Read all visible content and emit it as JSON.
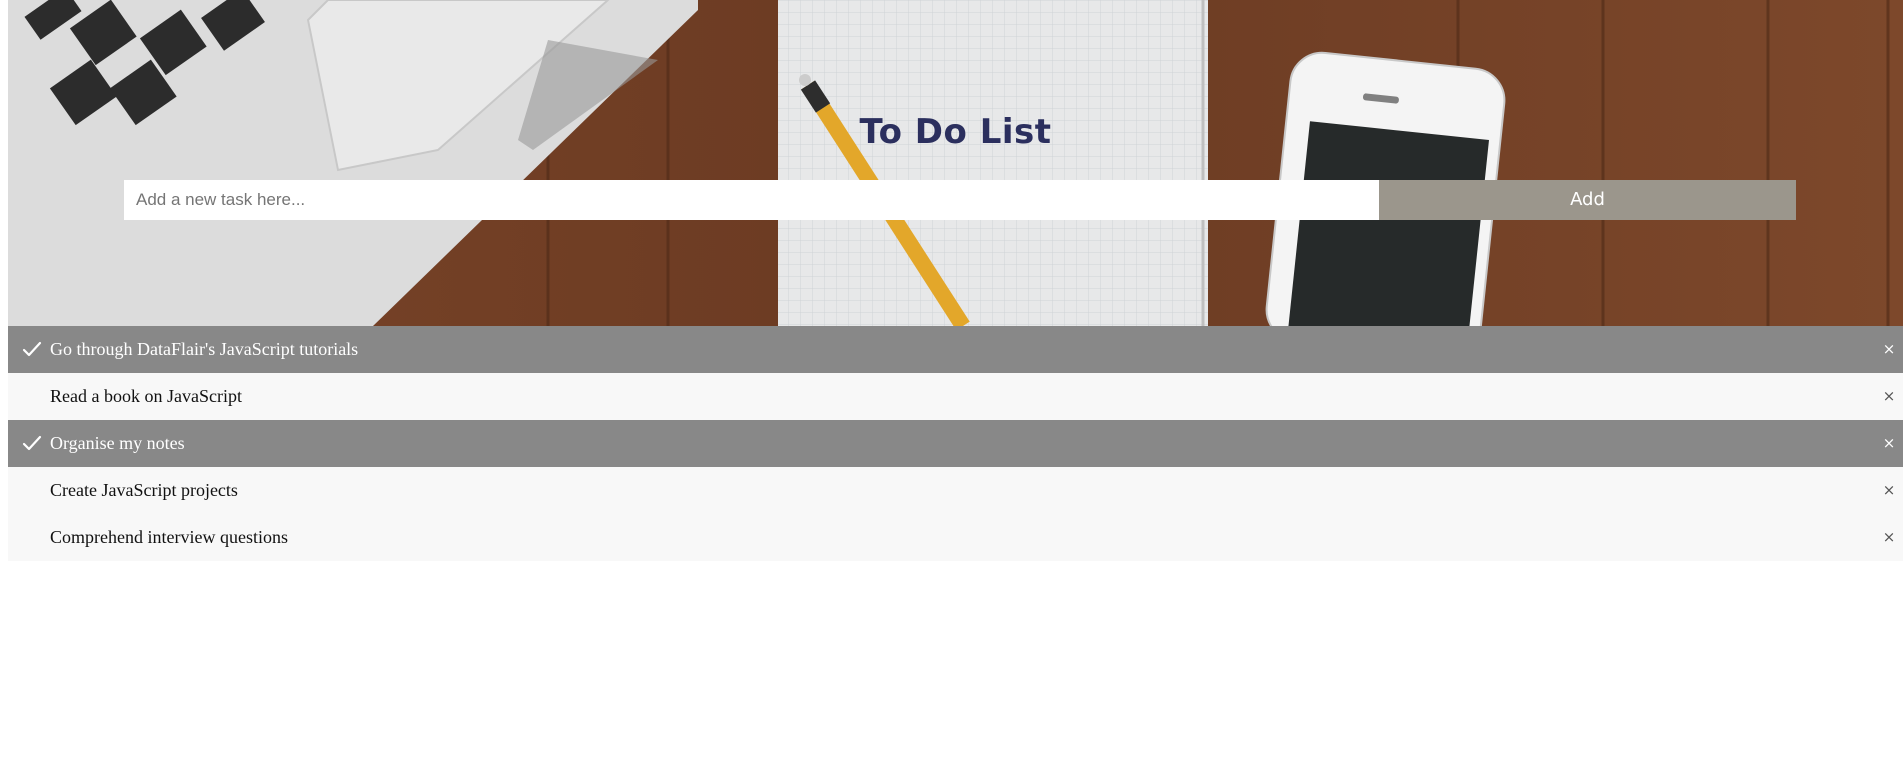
{
  "app": {
    "title": "To Do List"
  },
  "new_task": {
    "placeholder": "Add a new task here...",
    "value": "",
    "add_label": "Add"
  },
  "tasks": [
    {
      "text": "Go through DataFlair's JavaScript tutorials",
      "checked": true,
      "close_label": "×"
    },
    {
      "text": "Read a book on JavaScript",
      "checked": false,
      "close_label": "×"
    },
    {
      "text": "Organise my notes",
      "checked": true,
      "close_label": "×"
    },
    {
      "text": "Create JavaScript projects",
      "checked": false,
      "close_label": "×"
    },
    {
      "text": "Comprehend interview questions",
      "checked": false,
      "close_label": "×"
    }
  ],
  "colors": {
    "title": "#2b2f5e",
    "add_button": "#9b968c",
    "checked_row": "#888888",
    "unchecked_row": "#f8f8f8"
  },
  "icons": {
    "checked": "check-icon",
    "remove": "close-icon"
  }
}
